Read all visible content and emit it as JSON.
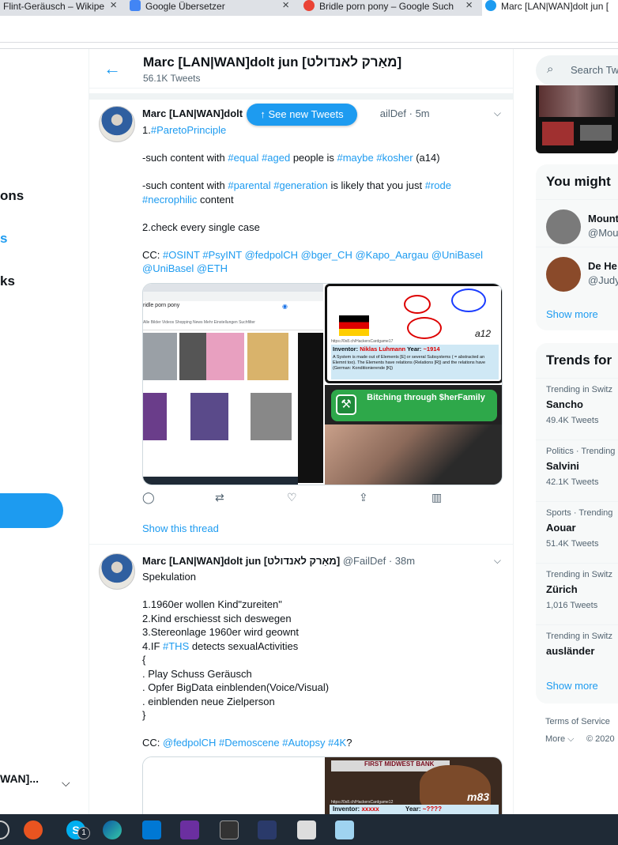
{
  "browser": {
    "tabs": [
      {
        "label": "Flint-Geräusch – Wikipe",
        "favicon_color": "#dee1e6"
      },
      {
        "label": "Google Übersetzer",
        "favicon_color": "#4285f4"
      },
      {
        "label": "Bridle porn pony – Google Such",
        "favicon_color": "#ea4335"
      },
      {
        "label": "Marc [LAN|WAN]dolt jun [",
        "favicon_color": "#1d9bf0"
      }
    ]
  },
  "leftnav": {
    "items": [
      "ons",
      "s",
      "ks"
    ],
    "account_name": "WAN]...",
    "chevron": "chevron-down-icon"
  },
  "header": {
    "back_icon": "←",
    "name": "Marc [LAN|WAN]dolt jun [מאַרק לאנדולט]",
    "tweet_count": "56.1K Tweets"
  },
  "see_new_tweets": "↑  See new Tweets",
  "tweets": [
    {
      "name": "Marc [LAN|WAN]dolt",
      "handle_suffix": "ailDef",
      "time": "· 5m",
      "lines": [
        [
          {
            "t": "1."
          },
          {
            "t": "#ParetoPrinciple",
            "tag": true
          }
        ],
        [],
        [
          {
            "t": "-such content with "
          },
          {
            "t": "#equal",
            "tag": true
          },
          {
            "t": " "
          },
          {
            "t": "#aged",
            "tag": true
          },
          {
            "t": " people is "
          },
          {
            "t": "#maybe",
            "tag": true
          },
          {
            "t": " "
          },
          {
            "t": "#kosher",
            "tag": true
          },
          {
            "t": " (a14)"
          }
        ],
        [],
        [
          {
            "t": "-such content with "
          },
          {
            "t": "#parental",
            "tag": true
          },
          {
            "t": " "
          },
          {
            "t": "#generation",
            "tag": true
          },
          {
            "t": " is likely that you just "
          },
          {
            "t": "#rode",
            "tag": true
          }
        ],
        [
          {
            "t": "#necrophilic",
            "tag": true
          },
          {
            "t": " content"
          }
        ],
        [],
        [
          {
            "t": "2.check every single case"
          }
        ],
        [],
        [
          {
            "t": "CC: "
          },
          {
            "t": "#OSINT",
            "tag": true
          },
          {
            "t": " "
          },
          {
            "t": "#PsyINT",
            "tag": true
          },
          {
            "t": " "
          },
          {
            "t": "@fedpolCH",
            "tag": true
          },
          {
            "t": " "
          },
          {
            "t": "@bger_CH",
            "tag": true
          },
          {
            "t": " "
          },
          {
            "t": "@Kapo_Aargau",
            "tag": true
          },
          {
            "t": " "
          },
          {
            "t": "@UniBasel",
            "tag": true
          }
        ],
        [
          {
            "t": "@UniBasel",
            "tag": true
          },
          {
            "t": " "
          },
          {
            "t": "@ETH",
            "tag": true
          }
        ]
      ],
      "media": {
        "search_query": "ridle porn pony",
        "search_tabs": "Alle  Bilder  Videos  Shopping  News  Mehr  Einstellungen  Suchfilter",
        "inventor_label": "Inventor:",
        "inventor_name": "Niklas Luhmann",
        "year_label": "Year:",
        "year": "~1914",
        "url": "https://0x8.ch/HackersCardgame17",
        "card_id": "a12",
        "system_text": "A System is made out of Elements [E] or several Subsystems ( = abstracted an Elemnt too). The Elements have relations (Relations [R]) and the relations have (German: Konditionierende [K])",
        "banner": "Bitching through $herFamily"
      },
      "show_thread": "Show this thread"
    },
    {
      "name": "Marc [LAN|WAN]dolt jun [מאַרק לאנדולט]",
      "handle": "@FailDef",
      "time": "· 38m",
      "lines": [
        [
          {
            "t": "Spekulation"
          }
        ],
        [],
        [
          {
            "t": "1.1960er wollen Kind\"zureiten\""
          }
        ],
        [
          {
            "t": "2.Kind erschiesst sich deswegen"
          }
        ],
        [
          {
            "t": "3.Stereonlage 1960er wird geownt"
          }
        ],
        [
          {
            "t": "4.IF "
          },
          {
            "t": "#THS",
            "tag": true
          },
          {
            "t": " detects sexualActivities"
          }
        ],
        [
          {
            "t": "{"
          }
        ],
        [
          {
            "t": ". Play Schuss Geräusch"
          }
        ],
        [
          {
            "t": ". Opfer BigData einblenden(Voice/Visual)"
          }
        ],
        [
          {
            "t": ". einblenden neue Zielperson"
          }
        ],
        [
          {
            "t": "}"
          }
        ],
        [],
        [
          {
            "t": "CC: "
          },
          {
            "t": "@fedpolCH",
            "tag": true
          },
          {
            "t": " "
          },
          {
            "t": "#Demoscene",
            "tag": true
          },
          {
            "t": " "
          },
          {
            "t": "#Autopsy",
            "tag": true
          },
          {
            "t": " "
          },
          {
            "t": "#4K",
            "tag": true
          },
          {
            "t": "?"
          }
        ]
      ],
      "media": {
        "card_id": "m83",
        "banner": "FIRST MIDWEST BANK",
        "url": "https://0x8.ch/HackersCardgame12",
        "inventor_label": "Inventor:",
        "inventor_name": "xxxxx",
        "year_label": "Year:",
        "year": "~????"
      }
    }
  ],
  "right": {
    "search_placeholder": "Search Twi",
    "search_icon": "search-icon",
    "you_might": {
      "title": "You might",
      "items": [
        {
          "name": "Mount",
          "handle": "@Mou",
          "avatar_color": "#7a7a7a"
        },
        {
          "name": "De He",
          "handle": "@Judy",
          "avatar_color": "#8a4a2a"
        }
      ],
      "show_more": "Show more"
    },
    "trends": {
      "title": "Trends for",
      "items": [
        {
          "context": "Trending in Switz",
          "name": "Sancho",
          "count": "49.4K Tweets"
        },
        {
          "context": "Politics · Trending",
          "name": "Salvini",
          "count": "42.1K Tweets"
        },
        {
          "context": "Sports · Trending",
          "name": "Aouar",
          "count": "51.4K Tweets"
        },
        {
          "context": "Trending in Switz",
          "name": "Zürich",
          "count": "1,016 Tweets"
        },
        {
          "context": "Trending in Switz",
          "name": "ausländer",
          "count": ""
        }
      ],
      "show_more": "Show more"
    },
    "footer": {
      "terms": "Terms of Service",
      "more": "More ⌵",
      "copyright": "© 2020"
    }
  },
  "taskbar": {
    "icons": [
      "ubuntu-icon",
      "skype-icon",
      "edge-icon",
      "mail-icon",
      "app-icon",
      "inkscape-icon",
      "vscode-icon",
      "piano-icon",
      "notes-icon"
    ],
    "skype_badge": "1"
  }
}
